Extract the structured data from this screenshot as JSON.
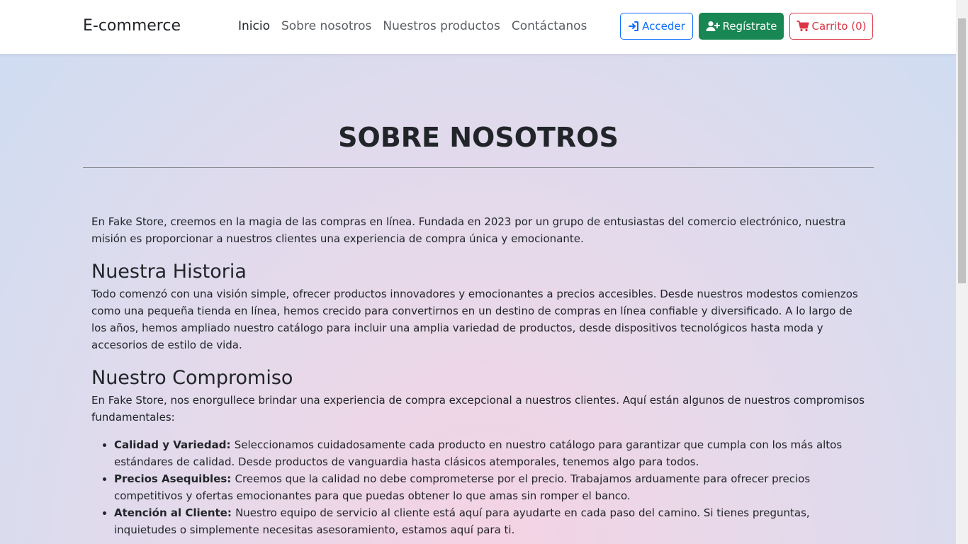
{
  "navbar": {
    "brand": "E-commerce",
    "links": [
      {
        "label": "Inicio"
      },
      {
        "label": "Sobre nosotros"
      },
      {
        "label": "Nuestros productos"
      },
      {
        "label": "Contáctanos"
      }
    ],
    "login_label": "Acceder",
    "register_label": "Regístrate",
    "cart_label": "Carrito (0)"
  },
  "colors": {
    "primary": "#0d6efd",
    "success": "#198754",
    "danger": "#dc3545"
  },
  "icons": {
    "login": "sign-in-icon",
    "register": "user-plus-icon",
    "cart": "shopping-cart-icon"
  },
  "page": {
    "title": "SOBRE NOSOTROS",
    "intro": "En Fake Store, creemos en la magia de las compras en línea. Fundada en 2023 por un grupo de entusiastas del comercio electrónico, nuestra misión es proporcionar a nuestros clientes una experiencia de compra única y emocionante.",
    "history_heading": "Nuestra Historia",
    "history_text": "Todo comenzó con una visión simple, ofrecer productos innovadores y emocionantes a precios accesibles. Desde nuestros modestos comienzos como una pequeña tienda en línea, hemos crecido para convertirnos en un destino de compras en línea confiable y diversificado. A lo largo de los años, hemos ampliado nuestro catálogo para incluir una amplia variedad de productos, desde dispositivos tecnológicos hasta moda y accesorios de estilo de vida.",
    "commitment_heading": "Nuestro Compromiso",
    "commitment_text": "En Fake Store, nos enorgullece brindar una experiencia de compra excepcional a nuestros clientes. Aquí están algunos de nuestros compromisos fundamentales:",
    "commitments": [
      {
        "title": "Calidad y Variedad:",
        "text": "Seleccionamos cuidadosamente cada producto en nuestro catálogo para garantizar que cumpla con los más altos estándares de calidad. Desde productos de vanguardia hasta clásicos atemporales, tenemos algo para todos."
      },
      {
        "title": "Precios Asequibles:",
        "text": "Creemos que la calidad no debe comprometerse por el precio. Trabajamos arduamente para ofrecer precios competitivos y ofertas emocionantes para que puedas obtener lo que amas sin romper el banco."
      },
      {
        "title": "Atención al Cliente:",
        "text": "Nuestro equipo de servicio al cliente está aquí para ayudarte en cada paso del camino. Si tienes preguntas, inquietudes o simplemente necesitas asesoramiento, estamos aquí para ti."
      }
    ]
  }
}
